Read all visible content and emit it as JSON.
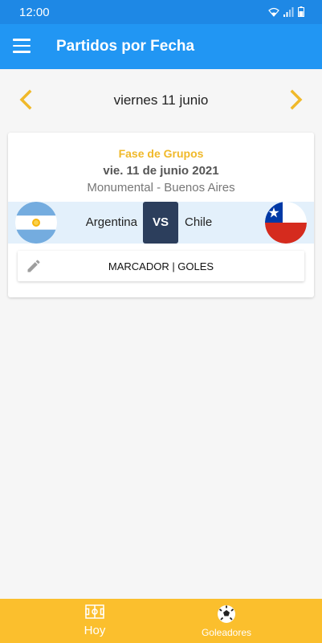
{
  "status_bar": {
    "time": "12:00",
    "icons": [
      "wifi-icon",
      "signal-icon",
      "battery-icon"
    ]
  },
  "app_bar": {
    "title": "Partidos por Fecha",
    "menu_icon": "menu-icon"
  },
  "date_nav": {
    "label": "viernes 11 junio",
    "prev_icon": "chevron-left-icon",
    "next_icon": "chevron-right-icon"
  },
  "match": {
    "phase": "Fase de Grupos",
    "date": "vie. 11 de junio 2021",
    "venue": "Monumental - Buenos Aires",
    "home_team": "Argentina",
    "away_team": "Chile",
    "vs_label": "VS",
    "score_label": "MARCADOR | GOLES"
  },
  "bottom_nav": {
    "items": [
      {
        "label": "Hoy",
        "icon": "field-icon"
      },
      {
        "label": "Goleadores",
        "icon": "soccer-ball-icon"
      }
    ]
  },
  "colors": {
    "primary": "#2196f3",
    "status_bar": "#1e88e5",
    "accent": "#f0b92a",
    "bottom_nav": "#fbbf2d",
    "vs_badge": "#2c3e5c"
  }
}
